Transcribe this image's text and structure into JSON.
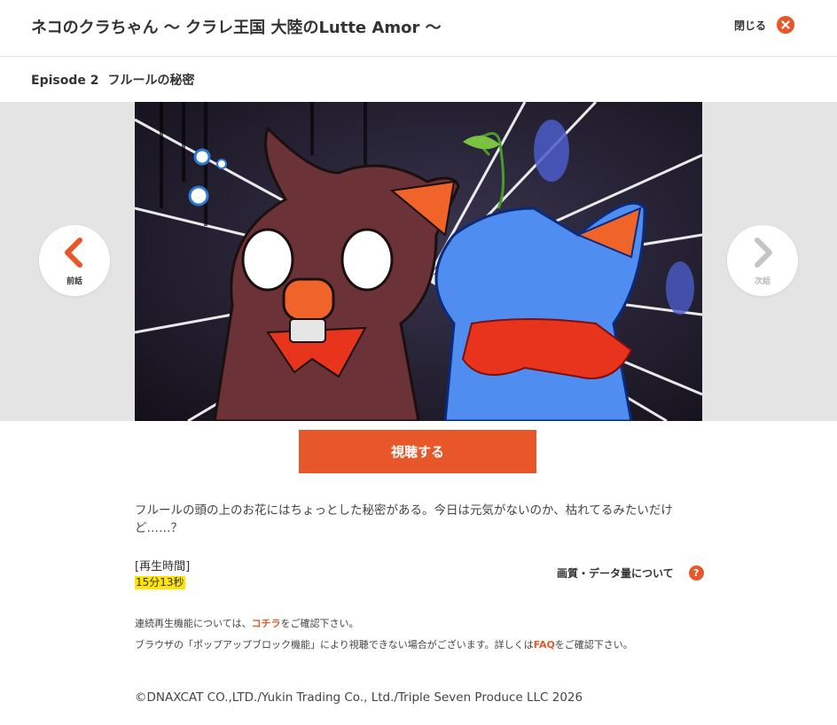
{
  "header": {
    "title": "ネコのクラちゃん ～ クラレ王国 大陸のLutte Amor ～",
    "close_label": "閉じる"
  },
  "episode": {
    "number": "Episode 2",
    "title": "フルールの秘密"
  },
  "nav": {
    "prev_label": "前話",
    "next_label": "次話",
    "prev_icon": "chevron-left-icon",
    "next_icon": "chevron-right-icon"
  },
  "watch_button": "視聴する",
  "description": "フルールの頭の上のお花にはちょっとした秘密がある。今日は元気がないのか、枯れてるみたいだけど……？",
  "runtime": {
    "label": "[再生時間]",
    "value": "15分13秒"
  },
  "quality_link": "画質・データ量について",
  "help_icon": "?",
  "notes": {
    "continuous_pre": "連続再生機能については、",
    "continuous_link": "コチラ",
    "continuous_post": "をご確認下さい。",
    "popup_pre": "ブラウザの「ポップアップブロック機能」により視聴できない場合がございます。詳しくは",
    "popup_link": "FAQ",
    "popup_post": "をご確認下さい。"
  },
  "copyright": "©DNAXCAT CO.,LTD./Yukin Trading Co., Ltd./Triple Seven Produce LLC 2026",
  "colors": {
    "accent": "#e8572a",
    "highlight": "#ffe500",
    "disabled": "#b8b8b8"
  }
}
